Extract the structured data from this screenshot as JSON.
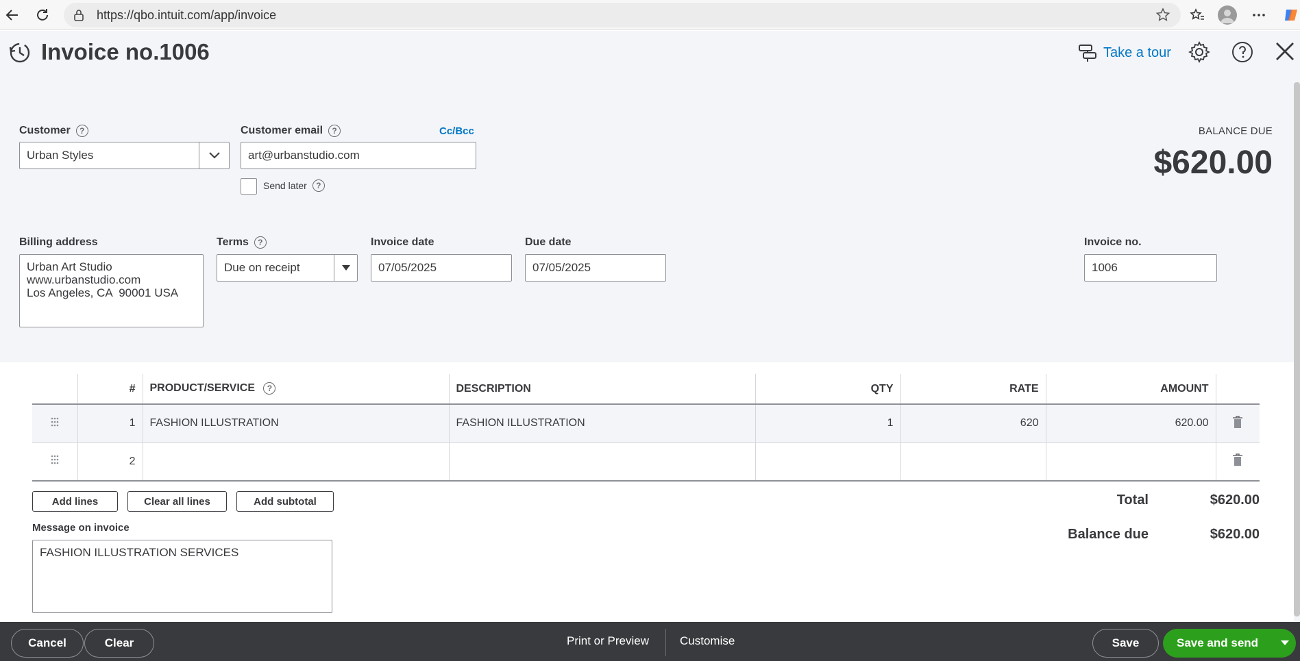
{
  "browser": {
    "url": "https://qbo.intuit.com/app/invoice"
  },
  "header": {
    "title": "Invoice no.1006",
    "take_tour": "Take a tour"
  },
  "customer": {
    "label": "Customer",
    "value": "Urban Styles"
  },
  "email": {
    "label": "Customer email",
    "value": "art@urbanstudio.com",
    "ccbcc": "Cc/Bcc",
    "send_later": "Send later"
  },
  "balance": {
    "label": "BALANCE DUE",
    "amount": "$620.00"
  },
  "billing": {
    "label": "Billing address",
    "value": "Urban Art Studio\nwww.urbanstudio.com\nLos Angeles, CA  90001 USA"
  },
  "terms": {
    "label": "Terms",
    "value": "Due on receipt"
  },
  "invoice_date": {
    "label": "Invoice date",
    "value": "07/05/2025"
  },
  "due_date": {
    "label": "Due date",
    "value": "07/05/2025"
  },
  "invoice_no": {
    "label": "Invoice no.",
    "value": "1006"
  },
  "table": {
    "headers": {
      "num": "#",
      "product": "PRODUCT/SERVICE",
      "description": "DESCRIPTION",
      "qty": "QTY",
      "rate": "RATE",
      "amount": "AMOUNT"
    },
    "rows": [
      {
        "num": "1",
        "product": "FASHION ILLUSTRATION",
        "description": "FASHION ILLUSTRATION",
        "qty": "1",
        "rate": "620",
        "amount": "620.00"
      },
      {
        "num": "2",
        "product": "",
        "description": "",
        "qty": "",
        "rate": "",
        "amount": ""
      }
    ]
  },
  "actions": {
    "add_lines": "Add lines",
    "clear_all_lines": "Clear all lines",
    "add_subtotal": "Add subtotal"
  },
  "totals": {
    "total_label": "Total",
    "total_value": "$620.00",
    "balance_label": "Balance due",
    "balance_value": "$620.00"
  },
  "message": {
    "label": "Message on invoice",
    "value": "FASHION ILLUSTRATION SERVICES"
  },
  "footer": {
    "cancel": "Cancel",
    "clear": "Clear",
    "print_preview": "Print or Preview",
    "customise": "Customise",
    "save": "Save",
    "save_send": "Save and send"
  },
  "colors": {
    "link": "#0077c5",
    "primary": "#2ca01c",
    "footer": "#393a3d"
  }
}
